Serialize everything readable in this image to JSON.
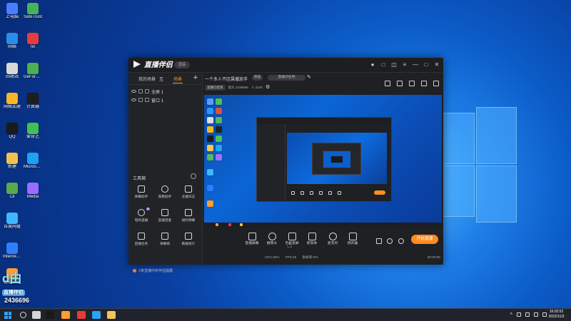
{
  "desktop": {
    "icons": [
      {
        "label": "上电脑",
        "color": "#4d7dff"
      },
      {
        "label": "SafeTrust",
        "color": "#46b35b"
      },
      {
        "label": "网络",
        "color": "#2c8de8"
      },
      {
        "label": "nn",
        "color": "#e43d3d"
      },
      {
        "label": "回收站",
        "color": "#d8d8d8"
      },
      {
        "label": "GeForce Experience",
        "color": "#4caf50"
      },
      {
        "label": "网络加速",
        "color": "#f8b524"
      },
      {
        "label": "计算器",
        "color": "#1e1e1e"
      },
      {
        "label": "QQ",
        "color": "#1a1a1a"
      },
      {
        "label": "爱奇艺",
        "color": "#40c057"
      },
      {
        "label": "新建",
        "color": "#f2c24e"
      },
      {
        "label": "Microsoft Edge",
        "color": "#1da1f2"
      },
      {
        "label": "Cli",
        "color": "#5aa94b"
      },
      {
        "label": "Media",
        "color": "#9b6cff"
      },
      {
        "label": "百度网盘",
        "color": "#3db8ff"
      },
      {
        "label": "Internet Explorer",
        "color": "#2d7fff"
      },
      {
        "label": "直播伴侣",
        "color": "#ff9c32"
      }
    ],
    "bottom_sticker": {
      "big": "d由",
      "small": "直播伴侣",
      "id": "2436696"
    }
  },
  "app": {
    "title": "直播伴侣",
    "version_badge": "国语",
    "left_tabs": [
      "我的场景",
      "互",
      "场景"
    ],
    "scenes": [
      {
        "name": "全屏 1"
      },
      {
        "name": "窗口 1"
      }
    ],
    "toolbox_title": "工具箱",
    "tools": [
      {
        "label": "弹幕助手"
      },
      {
        "label": "观看助手"
      },
      {
        "label": "主播日志"
      },
      {
        "label": "电商直播",
        "tag": "新"
      },
      {
        "label": "直播连麦"
      },
      {
        "label": "福利弹幕"
      },
      {
        "label": "直播任务"
      },
      {
        "label": "弹幕榜"
      },
      {
        "label": "数据统计"
      },
      {
        "label": "音频设置",
        "tag": "新"
      },
      {
        "label": "弹幕榜"
      },
      {
        "label": "数据统计"
      }
    ],
    "notice": "1条直播中的伴侣提醒",
    "stream": {
      "title": "一个多人不区属播放手",
      "pill_1": "频道",
      "pill_2": "直播间名称",
      "status_chip": "直播已结束",
      "stat_1": "观众 2436696",
      "stat_2": "人 2240"
    },
    "bottom_buttons": [
      {
        "label": "直播屏幕"
      },
      {
        "label": "摄像头"
      },
      {
        "label": "手机投屏"
      },
      {
        "label": "新窗体"
      },
      {
        "label": "麦克风"
      },
      {
        "label": "扬声器"
      }
    ],
    "start_live": "开始直播",
    "footer": {
      "cpu": "CPU:20%",
      "fps": "FPS:30",
      "net": "丢帧率:0%",
      "time": "00:00:00"
    }
  },
  "taskbar": {
    "time": "16:02:52",
    "date": "2022/11/3"
  }
}
